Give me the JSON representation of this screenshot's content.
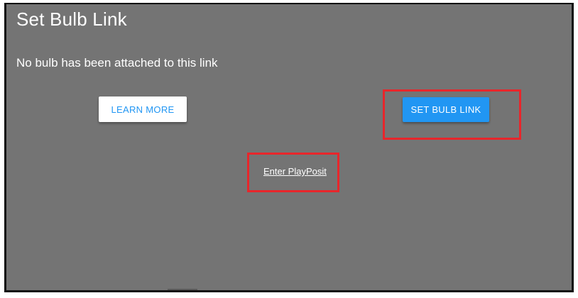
{
  "dialog": {
    "title": "Set Bulb Link",
    "message": "No bulb has been attached to this link",
    "learn_more_label": "LEARN MORE",
    "set_bulb_link_label": "SET BULB LINK",
    "enter_link_label": "Enter PlayPosit"
  },
  "colors": {
    "background": "#747474",
    "accent": "#2196f3",
    "highlight": "#e8262b"
  }
}
